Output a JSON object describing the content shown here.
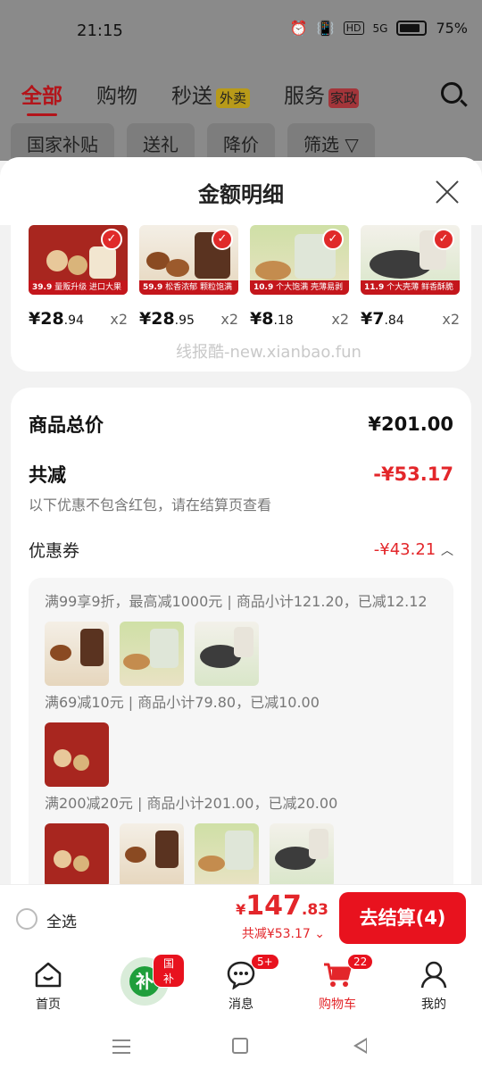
{
  "status_bar": {
    "time": "21:15",
    "battery": "75%",
    "network": "5G",
    "hd": "HD"
  },
  "bg_page": {
    "tabs": [
      {
        "label": "全部"
      },
      {
        "label": "购物"
      },
      {
        "label": "秒送",
        "tag": "外卖"
      },
      {
        "label": "服务",
        "tag": "家政"
      }
    ],
    "chips": [
      "国家补贴",
      "送礼",
      "降价",
      "筛选 ▽"
    ]
  },
  "sheet": {
    "title": "金额明细"
  },
  "products": [
    {
      "price_int": "¥28",
      "price_dec": ".94",
      "qty": "x2",
      "img_label": "量贩升级 进口大果",
      "img_tag": "39.9",
      "color": "#a8261f"
    },
    {
      "price_int": "¥28",
      "price_dec": ".95",
      "qty": "x2",
      "img_label": "松香浓郁 颗粒饱满",
      "img_tag": "59.9",
      "color": "#c98a4e"
    },
    {
      "price_int": "¥8",
      "price_dec": ".18",
      "qty": "x2",
      "img_label": "个大饱满 壳薄易剥",
      "img_tag": "10.9",
      "color": "#a7c46a"
    },
    {
      "price_int": "¥7",
      "price_dec": ".84",
      "qty": "x2",
      "img_label": "个大壳薄 鲜香酥脆",
      "img_tag": "11.9",
      "color": "#3c3c3c"
    }
  ],
  "watermark": "线报酷-new.xianbao.fun",
  "summary": {
    "total_label": "商品总价",
    "total_value": "¥201.00",
    "discount_label": "共减",
    "discount_value": "-¥53.17",
    "note": "以下优惠不包含红包，请在结算页查看",
    "coupon_label": "优惠券",
    "coupon_value": "-¥43.21",
    "coupon_groups": [
      {
        "text": "满99享9折，最高减1000元 | 商品小计121.20，已减12.12",
        "thumbs": [
          "#c98a4e",
          "#a7c46a",
          "#3c3c3c"
        ]
      },
      {
        "text": "满69减10元 | 商品小计79.80，已减10.00",
        "thumbs": [
          "#a8261f"
        ]
      },
      {
        "text": "满200减20元 | 商品小计201.00，已减20.00",
        "thumbs": [
          "#a8261f",
          "#c98a4e",
          "#a7c46a",
          "#3c3c3c"
        ]
      }
    ]
  },
  "checkout": {
    "select_all": "全选",
    "currency": "¥",
    "price_int": "147",
    "price_dec": ".83",
    "saved": "共减¥53.17 ⌄",
    "button": "去结算(4)"
  },
  "tabbar": [
    {
      "label": "首页"
    },
    {
      "label": "",
      "badge": "国补",
      "center": "补"
    },
    {
      "label": "消息",
      "badge": "5+"
    },
    {
      "label": "购物车",
      "badge": "22"
    },
    {
      "label": "我的"
    }
  ]
}
